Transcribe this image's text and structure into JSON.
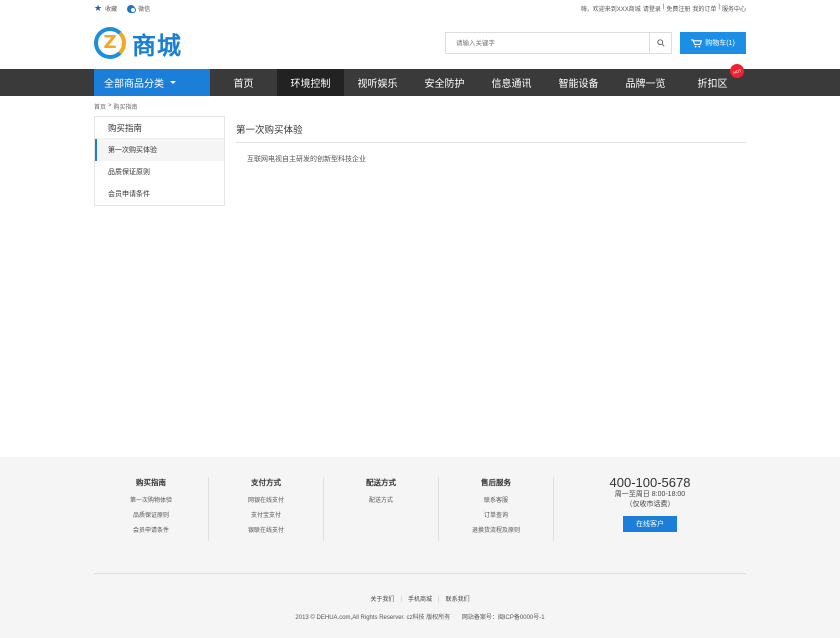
{
  "topbar": {
    "favorite": "收藏",
    "wechat": "微信",
    "welcome": "嗨，欢迎来到XXX商城",
    "login": "请登录",
    "register": "免费注册",
    "orders": "我的订单",
    "service": "服务中心"
  },
  "header": {
    "logo_text": "商城",
    "search_placeholder": "请输入关键字",
    "cart_label": "购物车(1)"
  },
  "nav": {
    "all_categories": "全部商品分类",
    "items": [
      {
        "label": "首页"
      },
      {
        "label": "环境控制"
      },
      {
        "label": "视听娱乐"
      },
      {
        "label": "安全防护"
      },
      {
        "label": "信息通讯"
      },
      {
        "label": "智能设备"
      },
      {
        "label": "品牌一览"
      },
      {
        "label": "折扣区"
      }
    ],
    "hot_badge": "HOT"
  },
  "breadcrumb": {
    "home": "首页",
    "sep": ">",
    "current": "购买指南"
  },
  "sidebar": {
    "title": "购买指南",
    "items": [
      {
        "label": "第一次购买体验"
      },
      {
        "label": "品质保证原则"
      },
      {
        "label": "会员申请条件"
      }
    ]
  },
  "content": {
    "title": "第一次购买体验",
    "body": "互联网电视自主研发的创新型科技企业"
  },
  "footer": {
    "cols": [
      {
        "title": "购买指南",
        "links": [
          "第一次购物体验",
          "品质保证原则",
          "会员申请条件"
        ]
      },
      {
        "title": "支付方式",
        "links": [
          "网银在线支付",
          "支付宝支付",
          "银联在线支付"
        ]
      },
      {
        "title": "配送方式",
        "links": [
          "配送方式"
        ]
      },
      {
        "title": "售后服务",
        "links": [
          "联系客服",
          "订单查询",
          "退换货流程及原则"
        ]
      }
    ],
    "phone": "400-100-5678",
    "hours": "周一至周日 8:00-18:00",
    "hours_note": "（仅收市话费）",
    "online_btn": "在线客户",
    "bottom_links": [
      "关于我们",
      "手机商城",
      "联系我们"
    ],
    "copyright": "2013 © DEHUA.com,All Rights Reserver. cz科技 版权所有",
    "icp": "网站备案号：闽ICP备0000号-1"
  }
}
